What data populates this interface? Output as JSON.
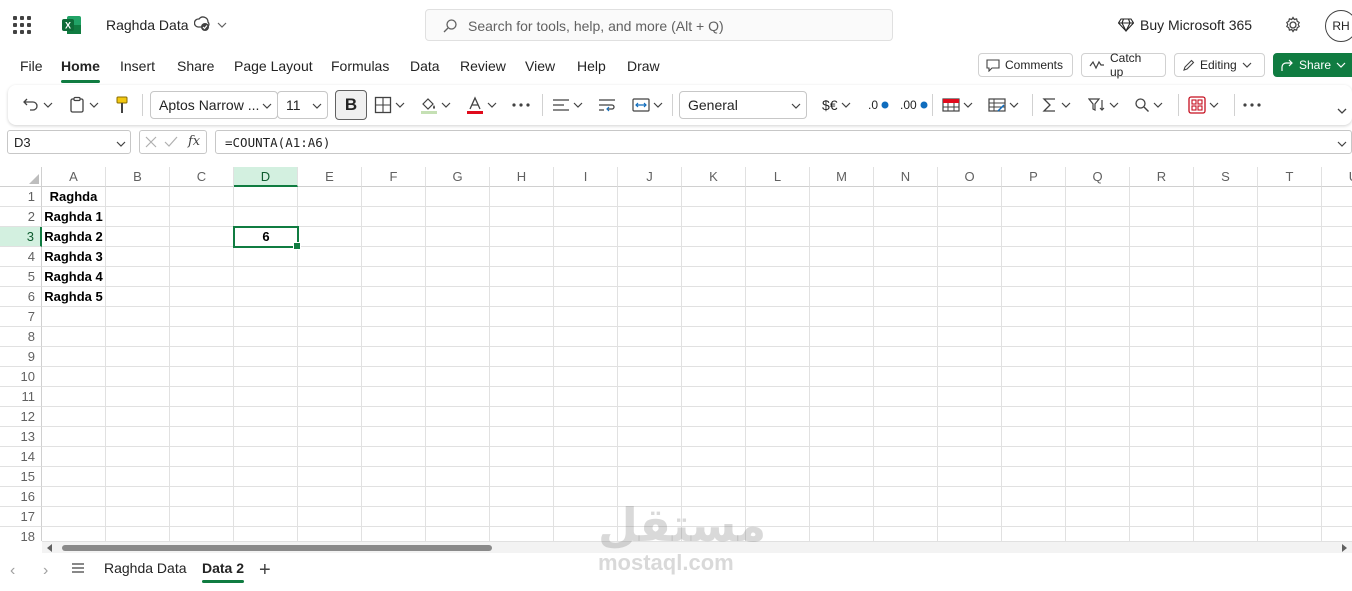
{
  "app": {
    "doc_title": "Raghda Data",
    "search_placeholder": "Search for tools, help, and more (Alt + Q)",
    "buy_label": "Buy Microsoft 365",
    "avatar_initials": "RH",
    "accent_color": "#107c41"
  },
  "menu": {
    "tabs": [
      "File",
      "Home",
      "Insert",
      "Share",
      "Page Layout",
      "Formulas",
      "Data",
      "Review",
      "View",
      "Help",
      "Draw"
    ],
    "active_tab": "Home",
    "comments_label": "Comments",
    "catchup_label": "Catch up",
    "editing_label": "Editing",
    "share_label": "Share"
  },
  "ribbon": {
    "font_name": "Aptos Narrow ...",
    "font_size": "11",
    "bold_label": "B",
    "number_format": "General",
    "currency_label": "$€",
    "dec_increase_label": ".0",
    "dec_decrease_label": ".00",
    "icons": [
      "undo-icon",
      "clipboard-icon",
      "format-painter-icon",
      "borders-icon",
      "fill-color-icon",
      "font-color-icon",
      "more-icon",
      "align-icon",
      "wrap-text-icon",
      "merge-icon",
      "conditional-format-icon",
      "format-table-icon",
      "autosum-icon",
      "sort-filter-icon",
      "find-icon",
      "addins-icon"
    ]
  },
  "formula_bar": {
    "name_box": "D3",
    "fx_label": "fx",
    "formula": "=COUNTA(A1:A6)"
  },
  "sheet": {
    "columns": [
      "A",
      "B",
      "C",
      "D",
      "E",
      "F",
      "G",
      "H",
      "I",
      "J",
      "K",
      "L",
      "M",
      "N",
      "O",
      "P",
      "Q",
      "R",
      "S",
      "T",
      "U"
    ],
    "rows": [
      "1",
      "2",
      "3",
      "4",
      "5",
      "6",
      "7",
      "8",
      "9",
      "10",
      "11",
      "12",
      "13",
      "14",
      "15",
      "16",
      "17",
      "18"
    ],
    "selected_column": "D",
    "selected_row": "3",
    "column_a_values": [
      "Raghda",
      "Raghda 1",
      "Raghda 2",
      "Raghda 3",
      "Raghda 4",
      "Raghda 5"
    ],
    "active_cell_value": "6"
  },
  "sheet_tabs": {
    "tabs": [
      "Raghda Data",
      "Data 2"
    ],
    "active": "Data 2",
    "add_label": "+"
  },
  "watermark": {
    "arabic": "مستقل",
    "latin": "mostaql.com"
  }
}
